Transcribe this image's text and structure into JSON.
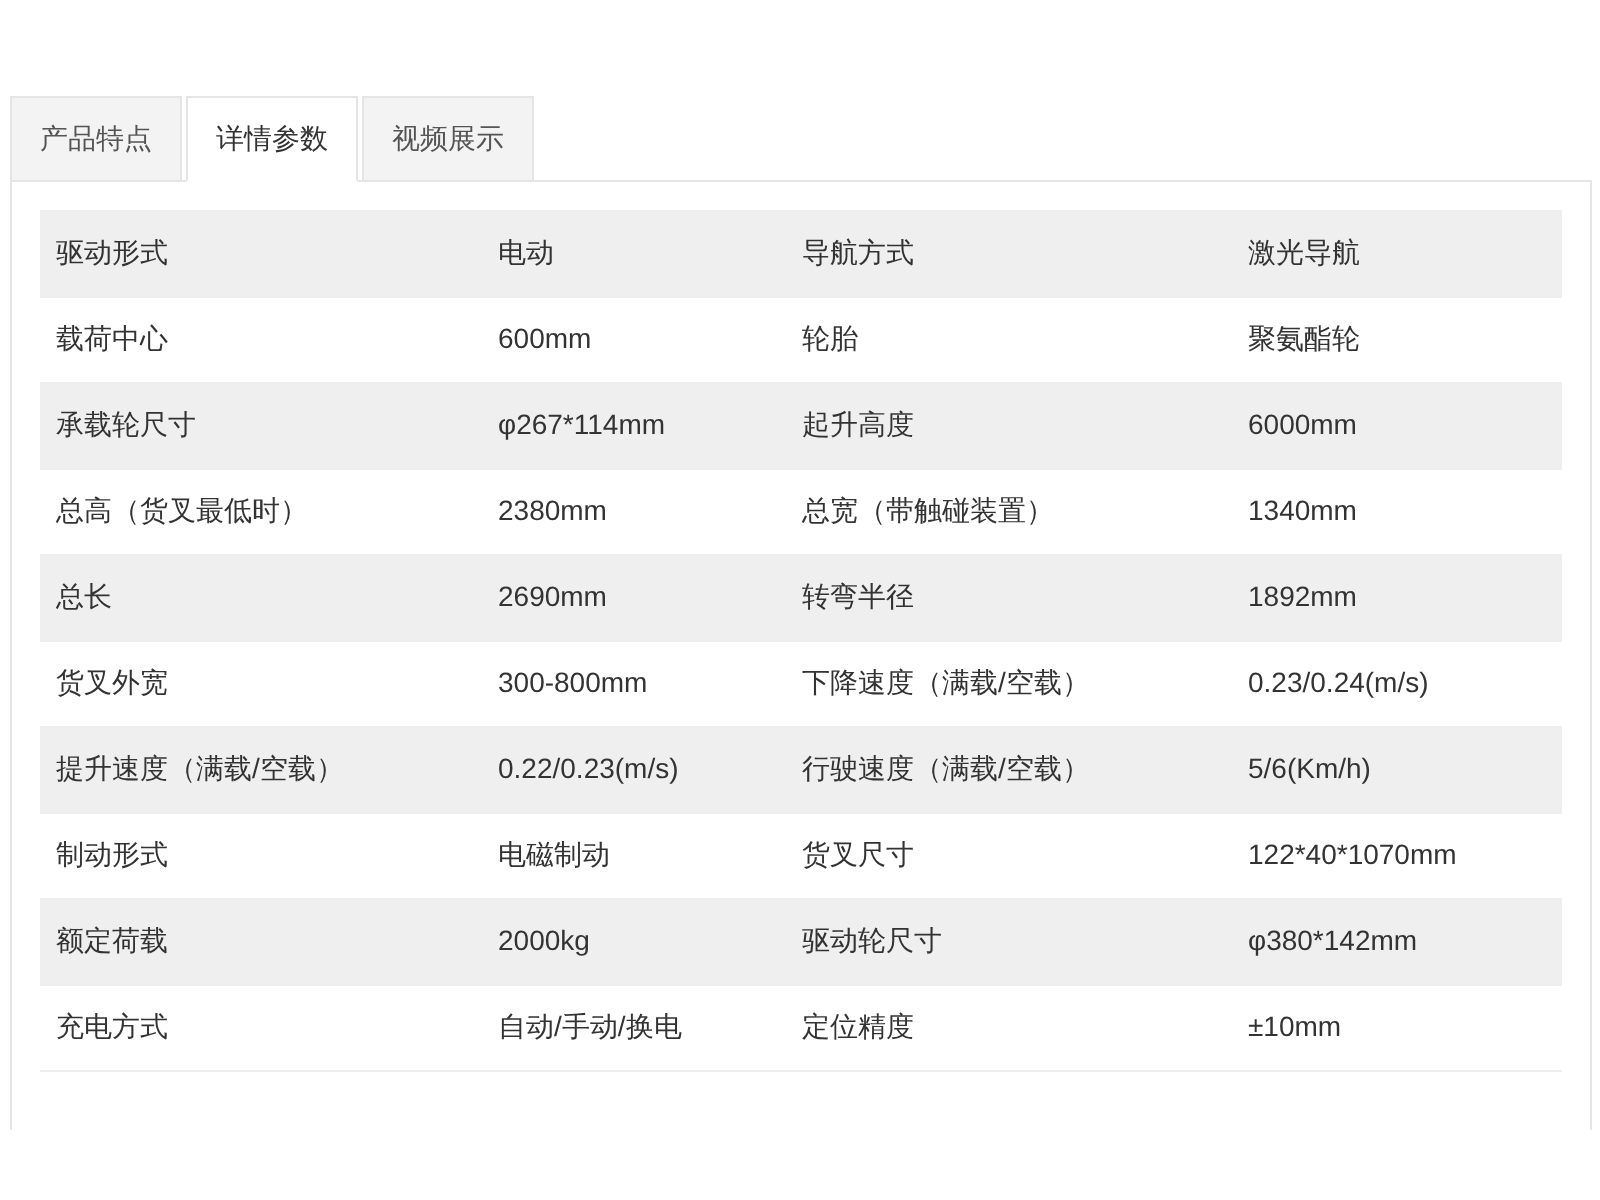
{
  "tabs": [
    {
      "label": "产品特点",
      "selected": false
    },
    {
      "label": "详情参数",
      "selected": true
    },
    {
      "label": "视频展示",
      "selected": false
    }
  ],
  "table": {
    "rows": [
      [
        "驱动形式",
        "电动",
        "导航方式",
        "激光导航"
      ],
      [
        "载荷中心",
        "600mm",
        "轮胎",
        "聚氨酯轮"
      ],
      [
        "承载轮尺寸",
        "φ267*114mm",
        "起升高度",
        "6000mm"
      ],
      [
        "总高（货叉最低时）",
        "2380mm",
        "总宽（带触碰装置）",
        "1340mm"
      ],
      [
        "总长",
        "2690mm",
        "转弯半径",
        "1892mm"
      ],
      [
        "货叉外宽",
        "300-800mm",
        "下降速度（满载/空载）",
        "0.23/0.24(m/s)"
      ],
      [
        "提升速度（满载/空载）",
        "0.22/0.23(m/s)",
        "行驶速度（满载/空载）",
        "5/6(Km/h)"
      ],
      [
        "制动形式",
        "电磁制动",
        "货叉尺寸",
        "122*40*1070mm"
      ],
      [
        "额定荷载",
        "2000kg",
        "驱动轮尺寸",
        "φ380*142mm"
      ],
      [
        "充电方式",
        "自动/手动/换电",
        "定位精度",
        "±10mm"
      ]
    ]
  }
}
